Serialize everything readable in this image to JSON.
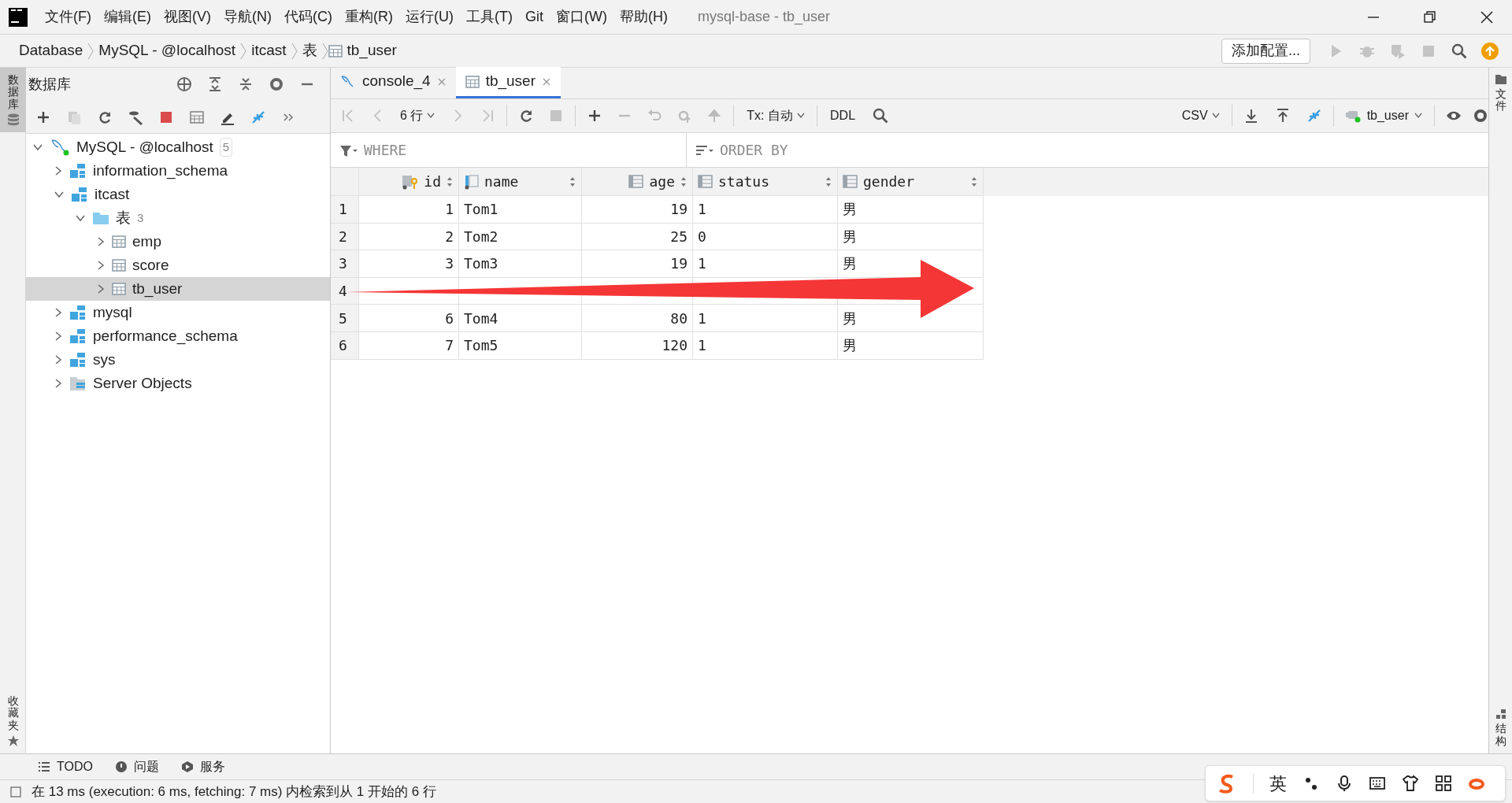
{
  "window": {
    "title": "mysql-base - tb_user"
  },
  "menu": [
    "文件(F)",
    "编辑(E)",
    "视图(V)",
    "导航(N)",
    "代码(C)",
    "重构(R)",
    "运行(U)",
    "工具(T)",
    "Git",
    "窗口(W)",
    "帮助(H)"
  ],
  "breadcrumb": [
    {
      "label": "Database",
      "kind": "text"
    },
    {
      "label": "MySQL - @localhost",
      "kind": "text"
    },
    {
      "label": "itcast",
      "kind": "text"
    },
    {
      "label": "表",
      "kind": "text"
    },
    {
      "label": "tb_user",
      "kind": "table"
    }
  ],
  "run_config_button": "添加配置...",
  "left_strip": [
    {
      "label": "数据库",
      "selected": true
    },
    {
      "label": "收藏夹",
      "selected": false
    }
  ],
  "db_panel": {
    "title": "数据库",
    "tree": [
      {
        "label": "MySQL - @localhost",
        "kind": "server",
        "badge": "5",
        "expanded": true,
        "selected": false,
        "children": [
          {
            "label": "information_schema",
            "kind": "schema",
            "expanded": false,
            "selected": false
          },
          {
            "label": "itcast",
            "kind": "schema",
            "expanded": true,
            "selected": false,
            "children": [
              {
                "label": "表",
                "kind": "folder",
                "badge": "3",
                "expanded": true,
                "selected": false,
                "children": [
                  {
                    "label": "emp",
                    "kind": "table",
                    "expanded": false,
                    "selected": false
                  },
                  {
                    "label": "score",
                    "kind": "table",
                    "expanded": false,
                    "selected": false
                  },
                  {
                    "label": "tb_user",
                    "kind": "table",
                    "expanded": false,
                    "selected": true
                  }
                ]
              }
            ]
          },
          {
            "label": "mysql",
            "kind": "schema",
            "expanded": false,
            "selected": false
          },
          {
            "label": "performance_schema",
            "kind": "schema",
            "expanded": false,
            "selected": false
          },
          {
            "label": "sys",
            "kind": "schema",
            "expanded": false,
            "selected": false
          },
          {
            "label": "Server Objects",
            "kind": "objects",
            "expanded": false,
            "selected": false
          }
        ]
      }
    ]
  },
  "editor_tabs": [
    {
      "label": "console_4",
      "kind": "console",
      "selected": false
    },
    {
      "label": "tb_user",
      "kind": "table",
      "selected": true
    }
  ],
  "grid_toolbar": {
    "row_count": "6 行",
    "tx": "Tx: 自动",
    "ddl": "DDL",
    "format": "CSV",
    "table_select": "tb_user"
  },
  "filters": {
    "where": {
      "placeholder": "WHERE"
    },
    "order_by": {
      "placeholder": "ORDER BY"
    }
  },
  "table": {
    "columns": [
      {
        "name": "id",
        "kind": "number",
        "key": true
      },
      {
        "name": "name",
        "kind": "text",
        "key": false
      },
      {
        "name": "age",
        "kind": "number",
        "key": false
      },
      {
        "name": "status",
        "kind": "text",
        "key": false
      },
      {
        "name": "gender",
        "kind": "text",
        "key": false
      }
    ],
    "rows": [
      {
        "number": "1",
        "cells": [
          "1",
          "Tom1",
          "19",
          "1",
          "男"
        ]
      },
      {
        "number": "2",
        "cells": [
          "2",
          "Tom2",
          "25",
          "0",
          "男"
        ]
      },
      {
        "number": "3",
        "cells": [
          "3",
          "Tom3",
          "19",
          "1",
          "男"
        ]
      },
      {
        "number": "4",
        "cells": []
      },
      {
        "number": "5",
        "cells": [
          "6",
          "Tom4",
          "80",
          "1",
          "男"
        ]
      },
      {
        "number": "6",
        "cells": [
          "7",
          "Tom5",
          "120",
          "1",
          "男"
        ]
      }
    ]
  },
  "bottom_tabs": [
    {
      "label": "TODO",
      "kind": "list"
    },
    {
      "label": "问题",
      "kind": "problems"
    },
    {
      "label": "服务",
      "kind": "services"
    }
  ],
  "status": "在 13 ms (execution: 6 ms, fetching: 7 ms) 内检索到从 1 开始的 6 行",
  "right_strip": [
    {
      "label": "文件",
      "kind": "folder"
    },
    {
      "label": "结构",
      "kind": "structure"
    }
  ],
  "ime_toolbar": {
    "language": "英"
  }
}
